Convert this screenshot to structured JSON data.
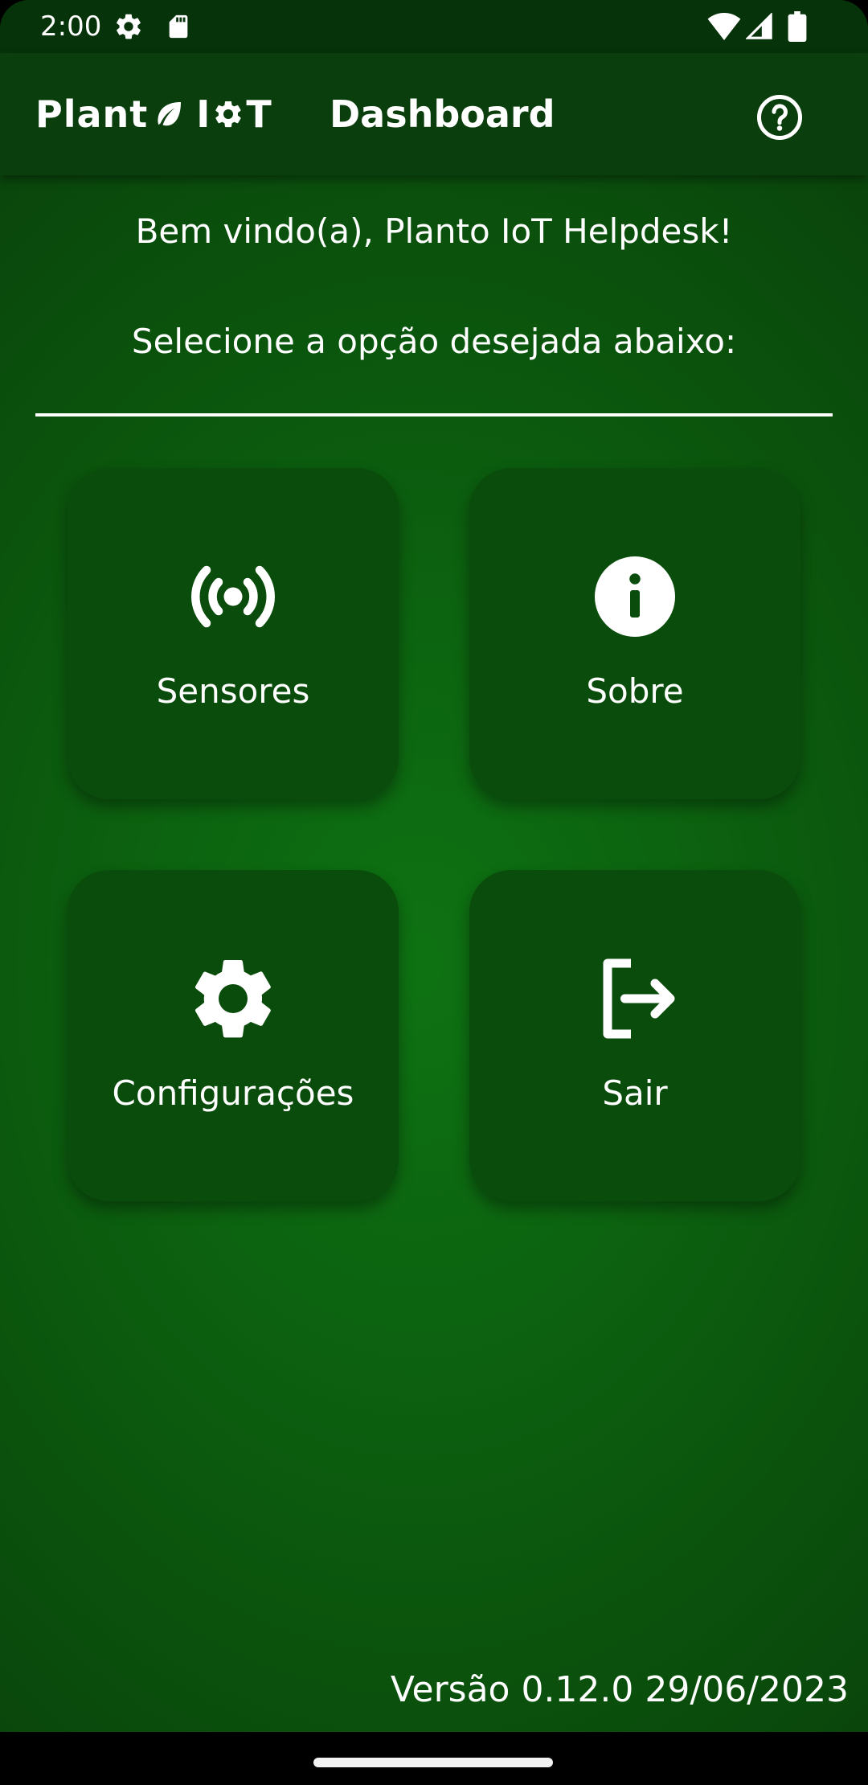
{
  "status_bar": {
    "time": "2:00",
    "left_icons": [
      "settings-gear-icon",
      "sd-card-icon"
    ],
    "right_icons": [
      "wifi-icon",
      "signal-icon",
      "battery-icon"
    ]
  },
  "app_bar": {
    "brand_prefix": "Plant",
    "brand_suffix_i": "I",
    "brand_suffix_t": "T",
    "brand_icons": [
      "leaf-icon",
      "gear-icon"
    ],
    "title": "Dashboard",
    "help_icon": "help-circle-icon"
  },
  "content": {
    "welcome": "Bem vindo(a), Planto IoT Helpdesk!",
    "instruction": "Selecione a opção desejada abaixo:"
  },
  "menu": [
    {
      "label": "Sensores",
      "icon": "sensor-broadcast-icon"
    },
    {
      "label": "Sobre",
      "icon": "info-icon"
    },
    {
      "label": "Configurações",
      "icon": "settings-icon"
    },
    {
      "label": "Sair",
      "icon": "logout-icon"
    }
  ],
  "footer": {
    "version": "Versão 0.12.0 29/06/2023"
  },
  "colors": {
    "status_bar": "#06330a",
    "app_bar": "#0a3e0d",
    "background": "#0c6410",
    "card": "#0a4c0b",
    "text": "#ffffff"
  }
}
